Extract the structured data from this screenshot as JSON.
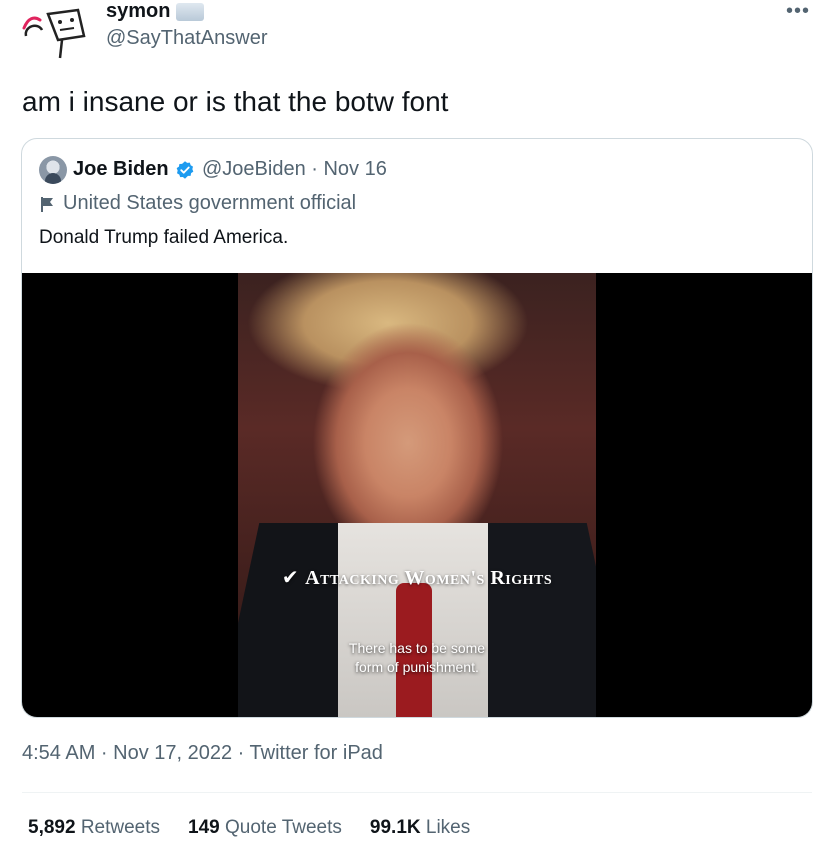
{
  "author": {
    "display_name": "symon",
    "handle": "@SayThatAnswer"
  },
  "tweet": {
    "text": "am i insane or is that the botw font",
    "timestamp": "4:54 AM · Nov 17, 2022 · Twitter for iPad"
  },
  "quoted": {
    "display_name": "Joe Biden",
    "handle_date": "@JoeBiden · Nov 16",
    "label": "United States government official",
    "text": "Donald Trump failed America.",
    "video": {
      "caption": "Attacking Women's Rights",
      "subtitle_line1": "There has to be some",
      "subtitle_line2": "form of punishment."
    }
  },
  "stats": {
    "retweets_count": "5,892",
    "retweets_label": "Retweets",
    "quotes_count": "149",
    "quotes_label": "Quote Tweets",
    "likes_count": "99.1K",
    "likes_label": "Likes"
  },
  "colors": {
    "verified": "#1d9bf0",
    "secondary_text": "#536471",
    "avatar_accent": "#e0245e"
  }
}
